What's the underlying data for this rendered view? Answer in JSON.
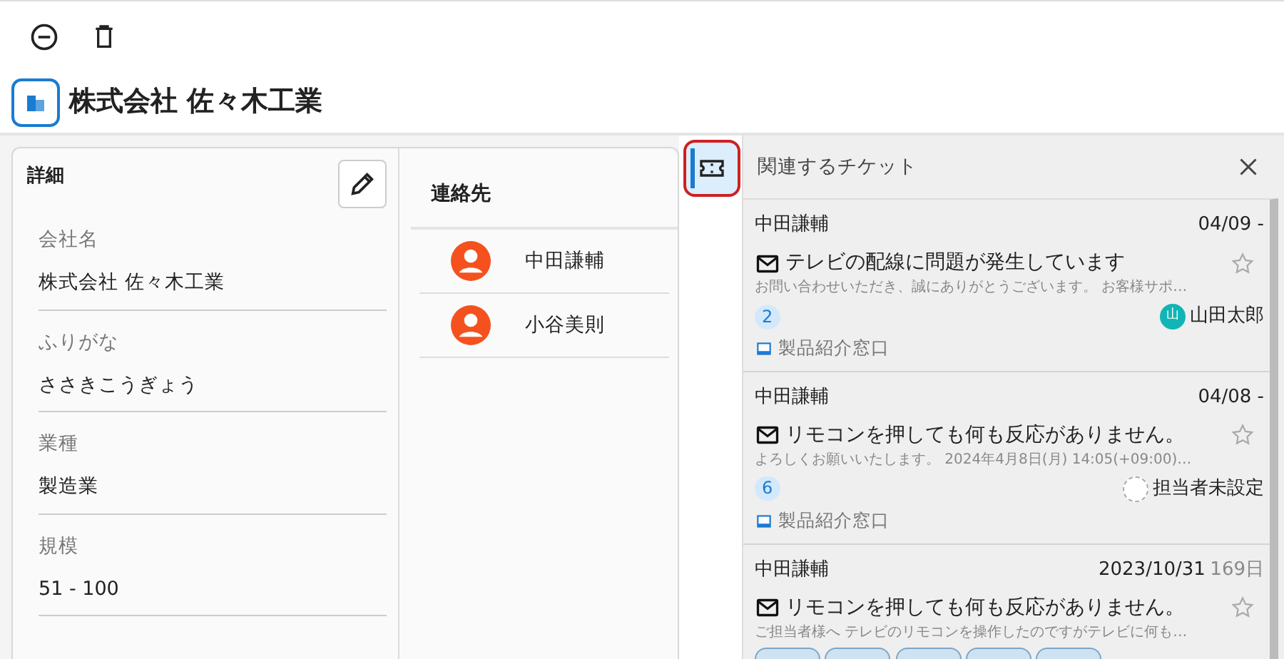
{
  "page_title": "株式会社 佐々木工業",
  "details": {
    "title": "詳細",
    "fields": [
      {
        "label": "会社名",
        "value": "株式会社 佐々木工業"
      },
      {
        "label": "ふりがな",
        "value": "ささきこうぎょう"
      },
      {
        "label": "業種",
        "value": "製造業"
      },
      {
        "label": "規模",
        "value": "51 - 100"
      }
    ]
  },
  "contacts": {
    "title": "連絡先",
    "items": [
      {
        "name": "中田謙輔"
      },
      {
        "name": "小谷美則"
      }
    ]
  },
  "side_tab": {
    "selected": true
  },
  "panel": {
    "title": "関連するチケット"
  },
  "tickets": [
    {
      "customer": "中田謙輔",
      "date": "04/09 -",
      "subject": "テレビの配線に問題が発生しています",
      "preview": "お問い合わせいただき、誠にありがとうございます。 お客様サポ…",
      "count": "2",
      "assignee": {
        "name": "山田太郎",
        "initial": "山",
        "assigned": true
      },
      "inbox": "製品紹介窓口",
      "starred": false
    },
    {
      "customer": "中田謙輔",
      "date": "04/08 -",
      "subject": "リモコンを押しても何も反応がありません。",
      "preview": "よろしくお願いいたします。 2024年4月8日(月) 14:05(+09:00)…",
      "count": "6",
      "assignee": {
        "name": "担当者未設定",
        "assigned": false
      },
      "inbox": "製品紹介窓口",
      "starred": false
    },
    {
      "customer": "中田謙輔",
      "date": "2023/10/31",
      "age": "169日",
      "subject": "リモコンを押しても何も反応がありません。",
      "preview": "ご担当者様へ テレビのリモコンを操作したのですがテレビに何も…",
      "tags": [
        {
          "kind": "cut"
        },
        {
          "kind": "cut"
        },
        {
          "kind": "cut"
        },
        {
          "kind": "cut"
        },
        {
          "kind": "cut"
        }
      ],
      "starred": false
    }
  ]
}
